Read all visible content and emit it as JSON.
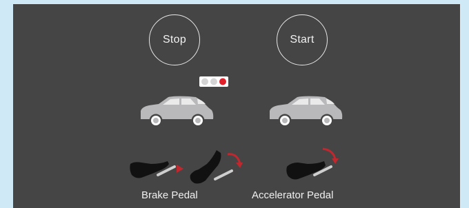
{
  "controls": {
    "stop_label": "Stop",
    "start_label": "Start"
  },
  "traffic_light": {
    "lamps": [
      "white",
      "white",
      "red"
    ],
    "colors": {
      "housing": "#ffffff",
      "lamp_off": "#d9d9d9",
      "lamp_on": "#e0202a"
    }
  },
  "pedals": {
    "brake_label": "Brake Pedal",
    "accelerator_label": "Accelerator Pedal"
  },
  "colors": {
    "background": "#cfe9f7",
    "panel": "#454545",
    "car": "#b9b9bb",
    "arrow": "#c0282f",
    "text": "#f0f0f0"
  }
}
